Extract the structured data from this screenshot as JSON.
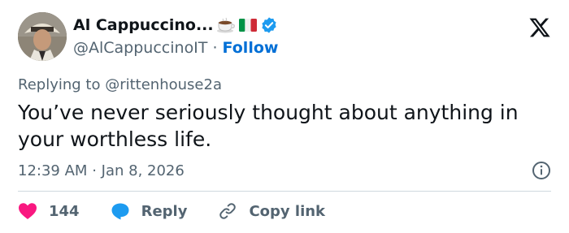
{
  "author": {
    "display_name": "Al Cappuccino...",
    "handle": "@AlCappuccinoIT",
    "separator": "·",
    "follow_label": "Follow",
    "badges": [
      "coffee-emoji",
      "italy-flag-emoji",
      "verified-badge-icon"
    ],
    "verified_color": "#1d9bf0"
  },
  "reply_context": {
    "prefix": "Replying to",
    "mention": "@rittenhouse2a"
  },
  "tweet": {
    "text": "You’ve never seriously thought about anything in your worthless life."
  },
  "meta": {
    "time": "12:39 AM",
    "separator": "·",
    "date": "Jan 8, 2026"
  },
  "actions": {
    "like_count": "144",
    "reply_label": "Reply",
    "copy_link_label": "Copy link",
    "like_color": "#f91880",
    "reply_color": "#1d9bf0"
  },
  "icons": [
    "x-logo-icon",
    "info-icon",
    "heart-icon",
    "reply-bubble-icon",
    "link-icon"
  ]
}
